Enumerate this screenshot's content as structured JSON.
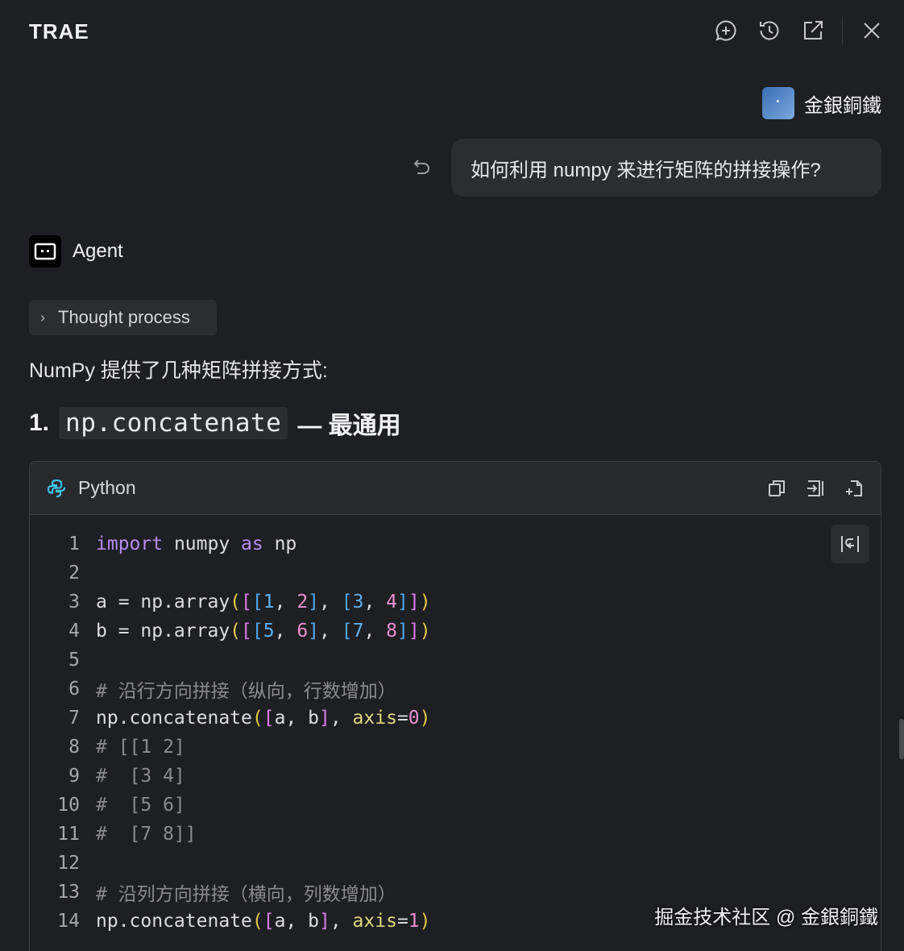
{
  "header": {
    "brand": "TRAE"
  },
  "user": {
    "name": "金銀銅鐵"
  },
  "message": {
    "text": "如何利用 numpy 来进行矩阵的拼接操作?"
  },
  "agent": {
    "name": "Agent"
  },
  "thought": {
    "label": "Thought process"
  },
  "response": {
    "intro": "NumPy 提供了几种矩阵拼接方式:",
    "heading": {
      "num": "1.",
      "code": "np.concatenate",
      "rest": "— 最通用"
    }
  },
  "codeblock": {
    "language": "Python",
    "lines": [
      {
        "n": "1"
      },
      {
        "n": "2"
      },
      {
        "n": "3"
      },
      {
        "n": "4"
      },
      {
        "n": "5"
      },
      {
        "n": "6"
      },
      {
        "n": "7"
      },
      {
        "n": "8"
      },
      {
        "n": "9"
      },
      {
        "n": "10"
      },
      {
        "n": "11"
      },
      {
        "n": "12"
      },
      {
        "n": "13"
      },
      {
        "n": "14"
      }
    ]
  },
  "watermark": "掘金技术社区 @ 金銀銅鐵"
}
